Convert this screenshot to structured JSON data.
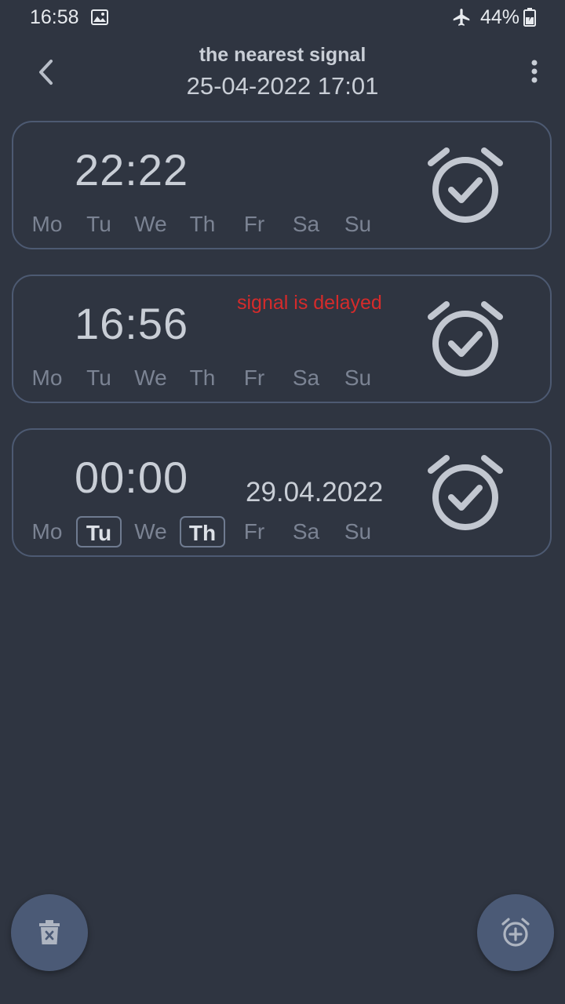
{
  "status_bar": {
    "time": "16:58",
    "battery": "44%",
    "icons": [
      "gallery-icon",
      "airplane-icon",
      "battery-icon"
    ]
  },
  "header": {
    "title": "the nearest signal",
    "subtitle": "25-04-2022 17:01",
    "icons": [
      "back-arrow-icon",
      "more-vert-icon"
    ]
  },
  "days": [
    "Mo",
    "Tu",
    "We",
    "Th",
    "Fr",
    "Sa",
    "Su"
  ],
  "alarms": [
    {
      "time": "22:22",
      "note": "",
      "date": "",
      "active_days": []
    },
    {
      "time": "16:56",
      "note": "signal is delayed",
      "date": "",
      "active_days": []
    },
    {
      "time": "00:00",
      "note": "",
      "date": "29.04.2022",
      "active_days": [
        "Tu",
        "Th"
      ]
    }
  ],
  "fabs": {
    "delete_icon": "trash-icon",
    "add_icon": "add-alarm-icon"
  },
  "colors": {
    "background": "#2f3541",
    "card_border": "#4d5a72",
    "text": "#c9ced6",
    "day_inactive": "#7b8393",
    "warning": "#d52b2b",
    "fab": "#4b5a76"
  }
}
